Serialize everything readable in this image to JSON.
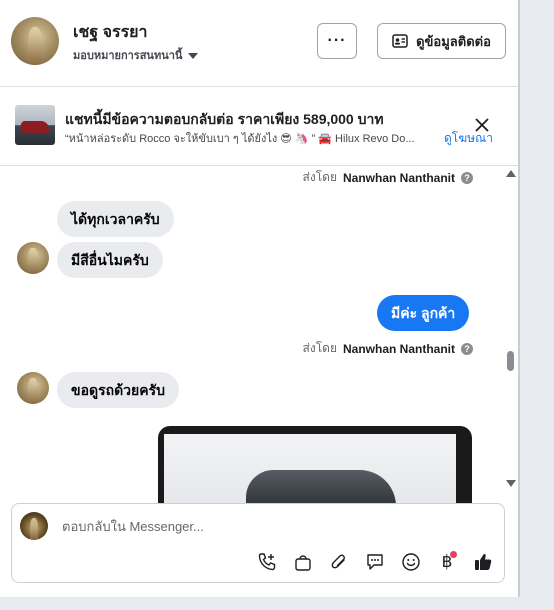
{
  "header": {
    "name": "เชฐ จรรยา",
    "subtitle": "มอบหมายการสนทนานี้",
    "more_label": "···",
    "contact_button": "ดูข้อมูลติดต่อ"
  },
  "ad": {
    "title": "แชทนี้มีข้อความตอบกลับต่อ ราคาเพียง 589,000 บาท",
    "text": "“หน้าหล่อระดับ Rocco จะให้ขับเบา ๆ ได้ยังไง 😎 🦄 ” 🚘 Hilux Revo Do...",
    "link": "ดูโฆษณา",
    "close_icon": "close-icon"
  },
  "messages": [
    {
      "type": "sent_by",
      "prefix": "ส่งโดย",
      "name": "Nanwhan Nanthanit"
    },
    {
      "type": "incoming",
      "text": "ได้ทุกเวลาครับ"
    },
    {
      "type": "incoming",
      "text": "มีสีอื่นไมครับ"
    },
    {
      "type": "outgoing",
      "text": "มีค่ะ  ลูกค้า"
    },
    {
      "type": "sent_by",
      "prefix": "ส่งโดย",
      "name": "Nanwhan Nanthanit"
    },
    {
      "type": "incoming",
      "text": "ขอดูรถด้วยครับ"
    },
    {
      "type": "image",
      "icon": "car-photo"
    }
  ],
  "composer": {
    "placeholder": "ตอบกลับใน Messenger...",
    "tools": [
      "phone-add-icon",
      "shopping-bag-icon",
      "paperclip-icon",
      "message-icon",
      "emoji-icon",
      "baht-icon",
      "thumbs-up-icon"
    ],
    "baht_symbol": "฿"
  },
  "colors": {
    "accent": "#1877f2",
    "bubble_in": "#e9ebee",
    "notification": "#e4405f"
  }
}
